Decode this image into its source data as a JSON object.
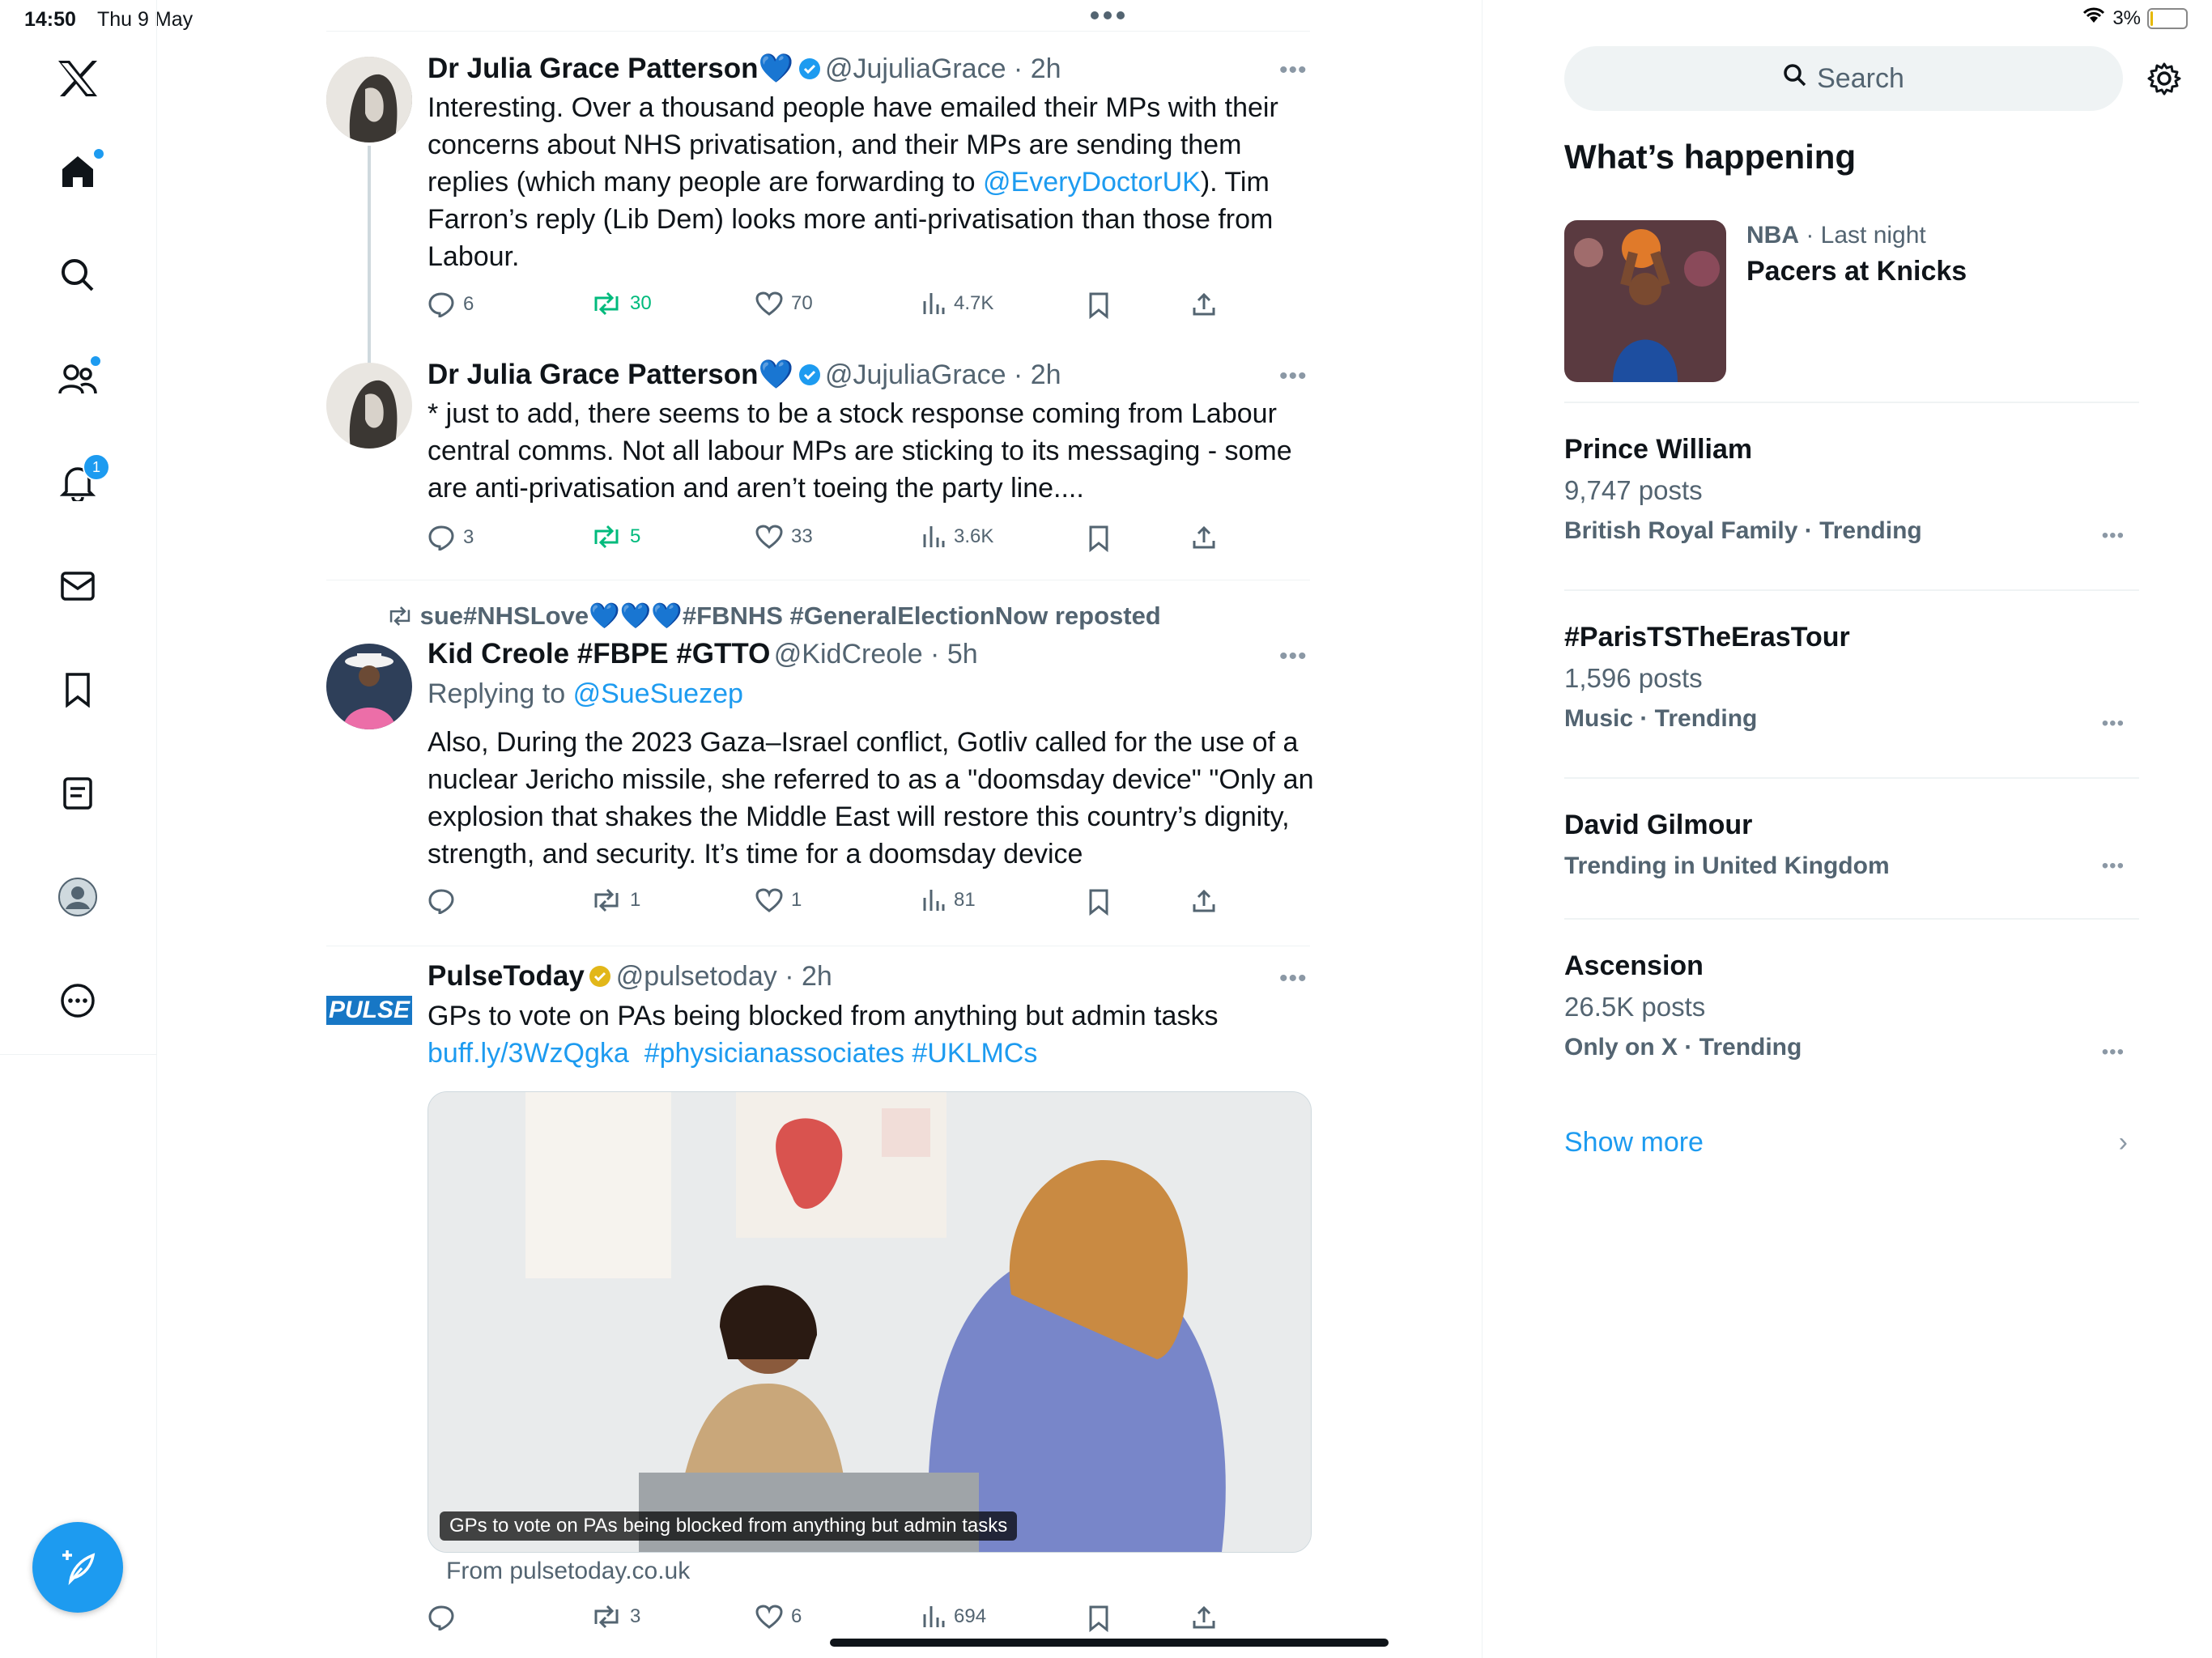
{
  "status_bar": {
    "time": "14:50",
    "date": "Thu 9 May",
    "battery": "3%",
    "battery_level": 0.03
  },
  "nav": {
    "items": [
      "x-logo",
      "home",
      "search",
      "communities",
      "notifications",
      "messages",
      "bookmarks",
      "lists",
      "profile",
      "more"
    ],
    "notifications_badge": "1"
  },
  "tweets": [
    {
      "name": "Dr Julia Grace Patterson💙",
      "handle": "@JujuliaGrace",
      "time": "2h",
      "text_pre": "Interesting. Over a thousand people have emailed their MPs with their concerns about NHS privatisation, and their MPs are sending them replies (which many people are forwarding to ",
      "text_link": "@EveryDoctorUK",
      "text_post": "). Tim Farron’s reply (Lib Dem) looks more anti-privatisation than those from Labour.",
      "replies": "6",
      "reposts": "30",
      "likes": "70",
      "views": "4.7K"
    },
    {
      "name": "Dr Julia Grace Patterson💙",
      "handle": "@JujuliaGrace",
      "time": "2h",
      "text": "* just to add, there seems to be a stock response coming from Labour central comms. Not all labour MPs are sticking to its messaging - some are anti-privatisation and aren’t toeing the party line....",
      "replies": "3",
      "reposts": "5",
      "likes": "33",
      "views": "3.6K"
    },
    {
      "reposted_by": "sue#NHSLove💙💙💙#FBNHS #GeneralElectionNow reposted",
      "name": "Kid Creole #FBPE #GTTO",
      "handle": "@KidCreole",
      "time": "5h",
      "replying_label": "Replying to",
      "replying_to": "@SueSuezep",
      "text": "Also, During the  2023 Gaza–Israel conflict, Gotliv called for the use of a nuclear Jericho missile, she referred to as a \"doomsday device\" \"Only an explosion that shakes the Middle East will restore this country’s dignity, strength, and security. It’s time for a doomsday device",
      "replies": "",
      "reposts": "1",
      "likes": "1",
      "views": "81"
    },
    {
      "name": "PulseToday",
      "handle": "@pulsetoday",
      "time": "2h",
      "avatar_text": "PULSE",
      "text": "GPs to vote on PAs being blocked from anything but admin tasks",
      "links": "buff.ly/3WzQgka  #physicianassociates #UKLMCs",
      "card_caption": "GPs to vote on PAs being blocked from anything but admin tasks",
      "card_source": "From pulsetoday.co.uk",
      "replies": "",
      "reposts": "3",
      "likes": "6",
      "views": "694"
    }
  ],
  "sidebar": {
    "search_placeholder": "Search",
    "title": "What’s happening",
    "featured": {
      "meta_category": "NBA",
      "meta_time": "Last night",
      "title": "Pacers at Knicks"
    },
    "trends": [
      {
        "title": "Prince William",
        "posts": "9,747 posts",
        "meta": "British Royal Family · Trending"
      },
      {
        "title": "#ParisTSTheErasTour",
        "posts": "1,596 posts",
        "meta": "Music · Trending"
      },
      {
        "title": "David Gilmour",
        "posts": "",
        "meta": "Trending in United Kingdom"
      },
      {
        "title": "Ascension",
        "posts": "26.5K posts",
        "meta": "Only on X · Trending"
      }
    ],
    "show_more": "Show more"
  },
  "colors": {
    "accent": "#1d9bf0",
    "repost_green": "#00ba7c",
    "verified_gold": "#e2b719",
    "text_secondary": "#536471"
  }
}
